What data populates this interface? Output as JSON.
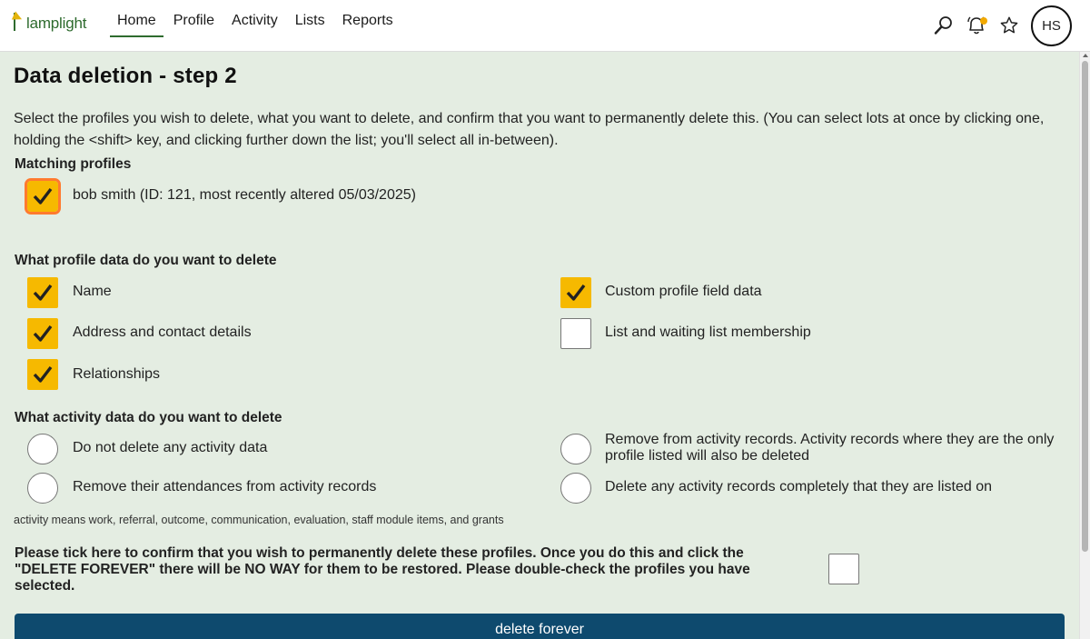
{
  "header": {
    "logo_text": "lamplight",
    "nav": [
      {
        "label": "Home",
        "active": true
      },
      {
        "label": "Profile"
      },
      {
        "label": "Activity"
      },
      {
        "label": "Lists"
      },
      {
        "label": "Reports"
      }
    ],
    "icons": [
      "search-icon",
      "bell-icon",
      "star-icon"
    ],
    "avatar_initials": "HS",
    "notification_dot_color": "#f2a900"
  },
  "page": {
    "title": "Data deletion - step 2",
    "intro": "Select the profiles you wish to delete, what you want to delete, and confirm that you want to permanently delete this. (You can select lots at once by clicking one, holding the <shift> key, and clicking further down the list; you'll select all in-between).",
    "matching_label": "Matching profiles",
    "profiles": [
      {
        "label": "bob smith (ID: 121, most recently altered 05/03/2025)",
        "checked": true
      }
    ],
    "profile_data_label": "What profile data do you want to delete",
    "profile_data_options": [
      {
        "label": "Name",
        "checked": true
      },
      {
        "label": "Address and contact details",
        "checked": true
      },
      {
        "label": "Relationships",
        "checked": true
      },
      {
        "label": "Custom profile field data",
        "checked": true
      },
      {
        "label": "List and waiting list membership",
        "checked": false
      }
    ],
    "activity_data_label": "What activity data do you want to delete",
    "activity_options": [
      {
        "label": "Do not delete any activity data",
        "selected": false
      },
      {
        "label": "Remove their attendances from activity records",
        "selected": false
      },
      {
        "label": "Remove from activity records. Activity records where they are the only profile listed will also be deleted",
        "selected": false
      },
      {
        "label": "Delete any activity records completely that they are listed on",
        "selected": false
      }
    ],
    "activity_note": "activity means work, referral, outcome, communication, evaluation, staff module items, and grants",
    "confirm_text": "Please tick here to confirm that you wish to permanently delete these profiles. Once you do this and click the \"DELETE FOREVER\" there will be NO WAY for them to be restored. Please double-check the profiles you have selected.",
    "confirm_checked": false,
    "delete_button": "delete forever"
  },
  "colors": {
    "brand_green": "#2e6b2e",
    "panel_bg": "#e4ede2",
    "checkbox_checked": "#f6b900",
    "focus_outline": "#ff7a2e",
    "button_bg": "#0e4a6e"
  }
}
